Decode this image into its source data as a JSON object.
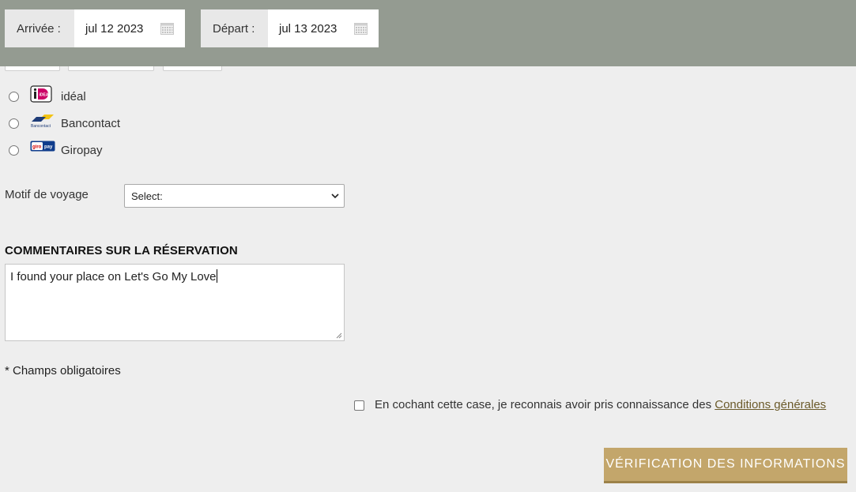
{
  "header": {
    "arrival": {
      "label": "Arrivée :",
      "value": "jul 12 2023",
      "icon": "calendar-icon"
    },
    "departure": {
      "label": "Départ :",
      "value": "jul 13 2023",
      "icon": "calendar-icon"
    },
    "background_color": "#949b91"
  },
  "payment_methods": [
    {
      "label": "idéal",
      "icon": "ideal-logo-icon"
    },
    {
      "label": "Bancontact",
      "icon": "bancontact-logo-icon"
    },
    {
      "label": "Giropay",
      "icon": "giropay-logo-icon"
    }
  ],
  "travel_reason": {
    "label": "Motif de voyage",
    "selected": "Select:"
  },
  "comments": {
    "heading": "COMMENTAIRES SUR LA RÉSERVATION",
    "value": "I found your place on Let's Go My Love"
  },
  "required_note": "* Champs obligatoires",
  "terms": {
    "text": "En cochant cette case, je reconnais avoir pris connaissance des ",
    "link": "Conditions générales"
  },
  "verify_button": {
    "label": "VÉRIFICATION DES INFORMATIONS",
    "color": "#c3a66b"
  }
}
